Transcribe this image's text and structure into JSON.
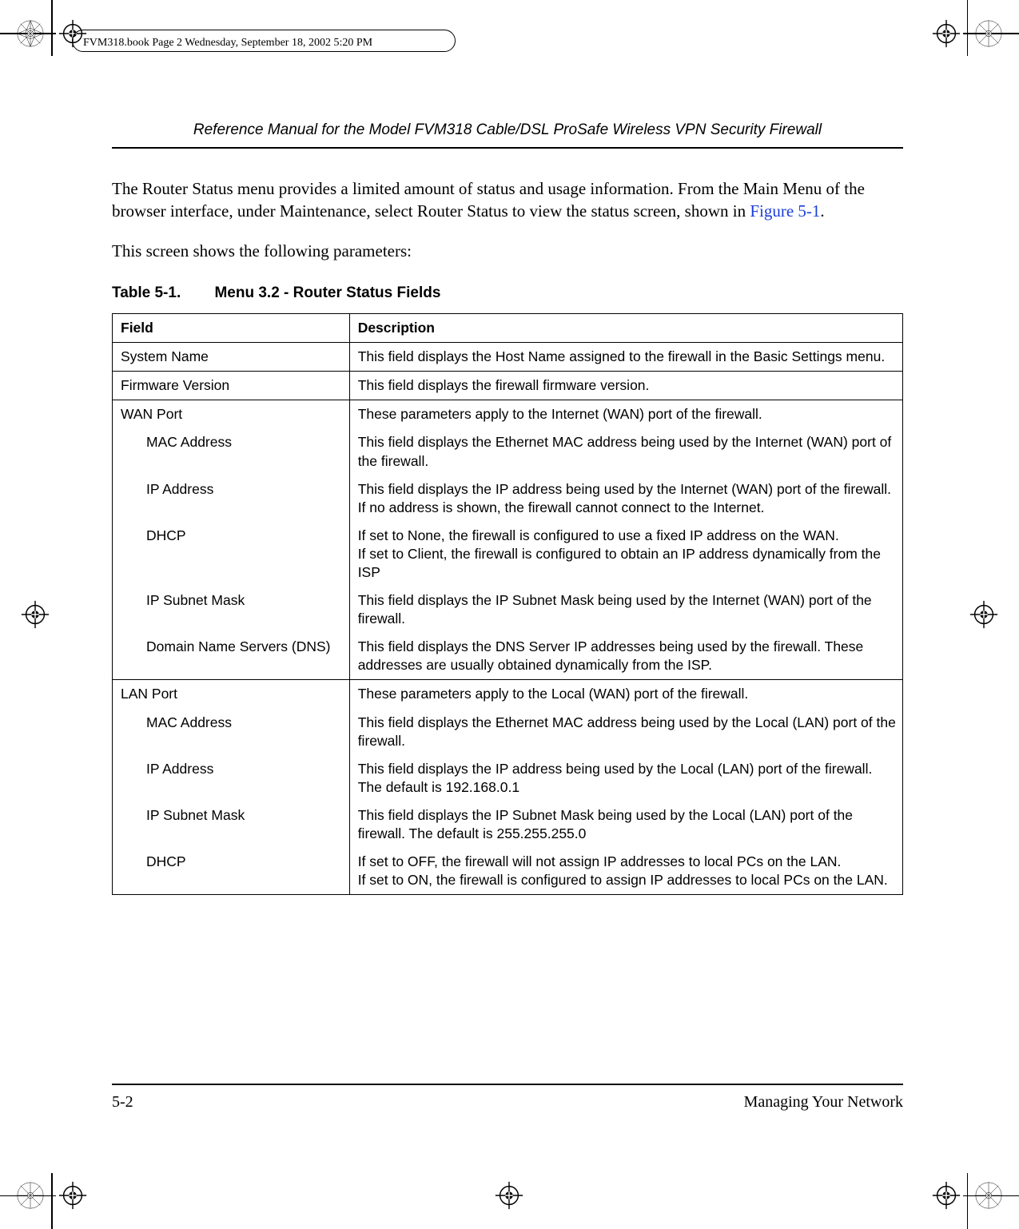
{
  "page_tag": "FVM318.book  Page 2  Wednesday, September 18, 2002  5:20 PM",
  "running_head": "Reference Manual for the Model FVM318 Cable/DSL ProSafe Wireless VPN Security Firewall",
  "para1_a": "The Router Status menu provides a limited amount of status and usage information. From the Main Menu of the browser interface, under Maintenance, select Router Status to view the status screen, shown in ",
  "para1_figref": "Figure 5-1",
  "para1_b": ".",
  "para2": "This screen shows the following parameters:",
  "table_caption_label": "Table 5-1.",
  "table_caption_title": "Menu 3.2 - Router Status Fields",
  "table": {
    "head_field": "Field",
    "head_desc": "Description",
    "rows": [
      {
        "field": "System Name",
        "desc": "This field displays the Host Name assigned to the firewall in the Basic Settings menu."
      },
      {
        "field": "Firmware Version",
        "desc": "This field displays the firewall firmware version."
      }
    ],
    "wan": {
      "label": "WAN Port",
      "desc": "These parameters apply to the Internet (WAN) port of the firewall.",
      "sub": [
        {
          "field": "MAC Address",
          "desc": "This field displays the Ethernet MAC address being used by the Internet (WAN) port of the firewall."
        },
        {
          "field": "IP Address",
          "desc": "This field displays the IP address being used by the Internet (WAN) port of the firewall. If no address is shown, the firewall cannot connect to the Internet."
        },
        {
          "field": "DHCP",
          "desc": "If set to None, the firewall is configured to use a fixed IP address on the WAN.\nIf set to Client, the firewall is configured to obtain an IP address dynamically from the ISP"
        },
        {
          "field": "IP Subnet Mask",
          "desc": "This field displays the IP Subnet Mask being used by the Internet (WAN) port of the firewall."
        },
        {
          "field": "Domain Name Servers (DNS)",
          "desc": "This field displays the DNS Server IP addresses being used by the firewall. These addresses are usually obtained dynamically from the ISP."
        }
      ]
    },
    "lan": {
      "label": "LAN Port",
      "desc": "These parameters apply to the Local (WAN) port of the firewall.",
      "sub": [
        {
          "field": "MAC Address",
          "desc": "This field displays the Ethernet MAC address being used by the Local (LAN) port of the firewall."
        },
        {
          "field": "IP Address",
          "desc": "This field displays the IP address being used by the Local (LAN) port of the firewall. The default is 192.168.0.1"
        },
        {
          "field": "IP Subnet Mask",
          "desc": "This field displays the IP Subnet Mask being used by the Local (LAN) port of the firewall. The default is 255.255.255.0"
        },
        {
          "field": "DHCP",
          "desc": "If set to OFF, the firewall will not assign IP addresses to local PCs on the LAN.\nIf set to ON, the firewall is configured to assign IP addresses to local PCs on the LAN."
        }
      ]
    }
  },
  "footer_left": "5-2",
  "footer_right": "Managing Your Network"
}
